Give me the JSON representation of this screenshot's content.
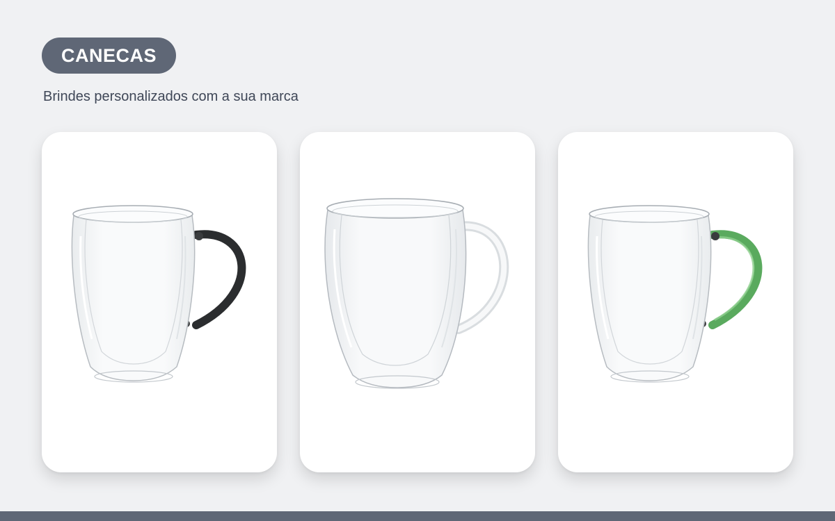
{
  "header": {
    "badge_label": "CANECAS",
    "subtitle": "Brindes personalizados com a sua marca"
  },
  "products": [
    {
      "image": "glass-mug-black-handle-icon",
      "handle_color": "#2b2d2f"
    },
    {
      "image": "glass-mug-clear-handle-icon",
      "handle_color": "#e6e8ea"
    },
    {
      "image": "glass-mug-green-handle-icon",
      "handle_color": "#5aaa5e"
    }
  ],
  "colors": {
    "background": "#f0f1f3",
    "badge": "#5f6776",
    "subtitle_text": "#3f4757",
    "card": "#ffffff",
    "footer": "#5f6776"
  }
}
